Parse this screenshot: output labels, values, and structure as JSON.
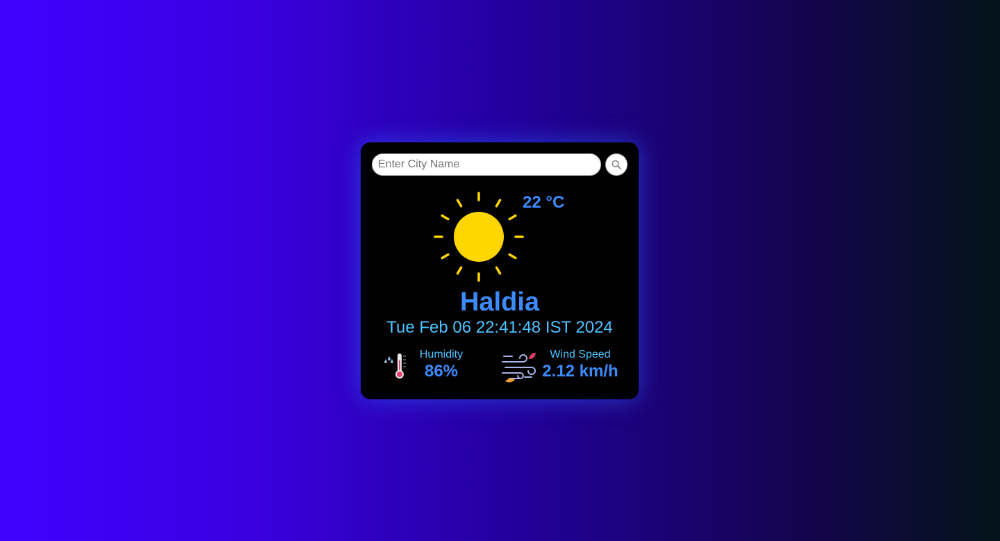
{
  "search": {
    "placeholder": "Enter City Name",
    "value": "",
    "button_icon": "search-icon"
  },
  "weather": {
    "icon": "sun-icon",
    "temperature": "22 °C",
    "city": "Haldia",
    "datetime": "Tue Feb 06 22:41:48 IST 2024"
  },
  "metrics": {
    "humidity": {
      "icon": "thermometer-humidity-icon",
      "label": "Humidity",
      "value": "86%"
    },
    "wind": {
      "icon": "wind-icon",
      "label": "Wind Speed",
      "value": "2.12 km/h"
    }
  },
  "colors": {
    "accent_blue": "#3d8bff",
    "accent_cyan": "#4fc3ff",
    "sun_yellow": "#ffd600",
    "card_background": "#000000"
  }
}
